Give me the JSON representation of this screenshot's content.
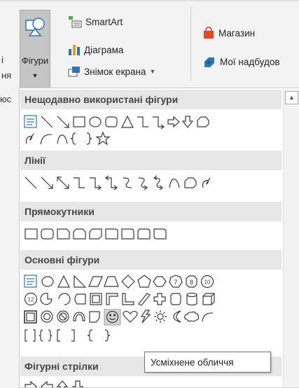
{
  "ribbon": {
    "shapes_button_label": "Фігури",
    "smartart_label": "SmartArt",
    "chart_label": "Діаграма",
    "screenshot_label": "Знімок екрана",
    "store_label": "Магазин",
    "my_addins_label": "Мої надбудов",
    "left_cut_1": "і",
    "left_cut_2": "ня",
    "left_cut_3": "юс"
  },
  "gallery": {
    "recent_header": "Нещодавно використані фігури",
    "lines_header": "Лінії",
    "rectangles_header": "Прямокутники",
    "basic_header": "Основні фігури",
    "block_arrows_header": "Фігурні стрілки",
    "hovered_shape": "smiley-face"
  },
  "tooltip": {
    "text": "Усміхнене обличчя"
  },
  "colors": {
    "ribbon_bg": "#f3f3f3",
    "header_bg": "#e6e6e6",
    "stroke": "#3a3a3a",
    "accent": "#2e75b6"
  }
}
